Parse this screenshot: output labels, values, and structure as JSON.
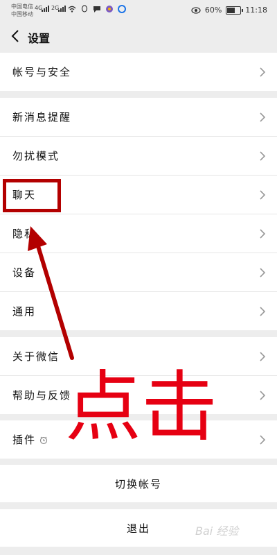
{
  "status_bar": {
    "carrier1": "中国电信",
    "carrier2": "中国移动",
    "signal1": "4G",
    "signal2": "2G",
    "battery_text": "60%",
    "battery_level": 0.6,
    "time": "11:18",
    "icons": [
      "wifi-icon",
      "qq-icon",
      "message-icon",
      "browser-icon",
      "app-icon",
      "eye-icon"
    ]
  },
  "nav": {
    "title": "设置"
  },
  "groups": [
    {
      "items": [
        "帐号与安全"
      ]
    },
    {
      "items": [
        "新消息提醒",
        "勿扰模式",
        "聊天",
        "隐私",
        "设备",
        "通用"
      ]
    },
    {
      "items": [
        "关于微信",
        "帮助与反馈"
      ]
    },
    {
      "items": [
        "插件"
      ]
    }
  ],
  "actions": {
    "switch_account": "切换帐号",
    "logout": "退出"
  },
  "annotation": {
    "text": "点击",
    "highlight_color": "#b30000",
    "text_color": "#e60012"
  },
  "watermark": "Bai 经验"
}
